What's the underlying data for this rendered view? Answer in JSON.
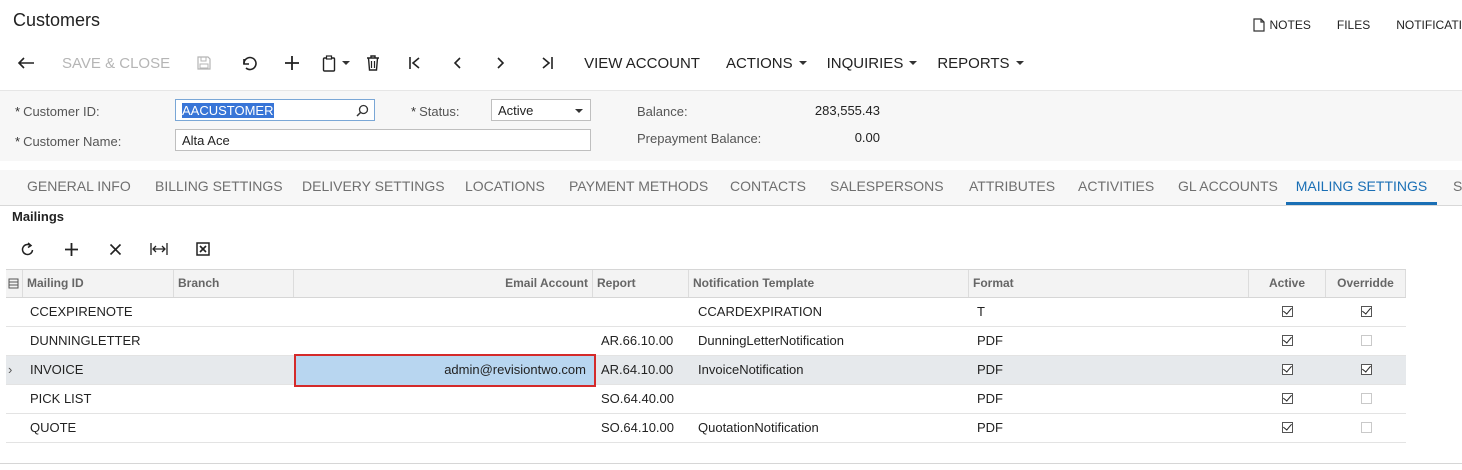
{
  "page": {
    "title": "Customers"
  },
  "top_links": [
    {
      "label": "NOTES",
      "icon": "note-icon"
    },
    {
      "label": "FILES"
    },
    {
      "label": "NOTIFICATI"
    }
  ],
  "toolbar": {
    "save_close": "SAVE & CLOSE",
    "view_account": "VIEW ACCOUNT",
    "actions": "ACTIONS",
    "inquiries": "INQUIRIES",
    "reports": "REPORTS"
  },
  "form": {
    "customer_id_label": "Customer ID:",
    "customer_id_value": "AACUSTOMER",
    "customer_name_label": "Customer Name:",
    "customer_name_value": "Alta Ace",
    "status_label": "Status:",
    "status_value": "Active",
    "balance_label": "Balance:",
    "balance_value": "283,555.43",
    "prepayment_label": "Prepayment Balance:",
    "prepayment_value": "0.00",
    "required_mark": "*"
  },
  "tabs": [
    "GENERAL INFO",
    "BILLING SETTINGS",
    "DELIVERY SETTINGS",
    "LOCATIONS",
    "PAYMENT METHODS",
    "CONTACTS",
    "SALESPERSONS",
    "ATTRIBUTES",
    "ACTIVITIES",
    "GL ACCOUNTS",
    "MAILING SETTINGS",
    "S"
  ],
  "active_tab": "MAILING SETTINGS",
  "section": {
    "title": "Mailings"
  },
  "grid": {
    "columns": {
      "mailing_id": "Mailing ID",
      "branch": "Branch",
      "email_account": "Email Account",
      "report": "Report",
      "notification_template": "Notification Template",
      "format": "Format",
      "active": "Active",
      "override": "Overridde"
    },
    "rows": [
      {
        "mailing_id": "CCEXPIRENOTE",
        "branch": "",
        "email_account": "",
        "report": "",
        "template": "CCARDEXPIRATION",
        "format": "T",
        "active": true,
        "override": true
      },
      {
        "mailing_id": "DUNNINGLETTER",
        "branch": "",
        "email_account": "",
        "report": "AR.66.10.00",
        "template": "DunningLetterNotification",
        "format": "PDF",
        "active": true,
        "override": false
      },
      {
        "mailing_id": "INVOICE",
        "branch": "",
        "email_account": "admin@revisiontwo.com",
        "report": "AR.64.10.00",
        "template": "InvoiceNotification",
        "format": "PDF",
        "active": true,
        "override": true
      },
      {
        "mailing_id": "PICK LIST",
        "branch": "",
        "email_account": "",
        "report": "SO.64.40.00",
        "template": "",
        "format": "PDF",
        "active": true,
        "override": false
      },
      {
        "mailing_id": "QUOTE",
        "branch": "",
        "email_account": "",
        "report": "SO.64.10.00",
        "template": "QuotationNotification",
        "format": "PDF",
        "active": true,
        "override": false
      }
    ],
    "selected_row": 2,
    "row_pointer": "›"
  },
  "colors": {
    "accent": "#1a6fb5",
    "highlight": "#b8d6f0",
    "highlight_border": "#d42a2a"
  }
}
